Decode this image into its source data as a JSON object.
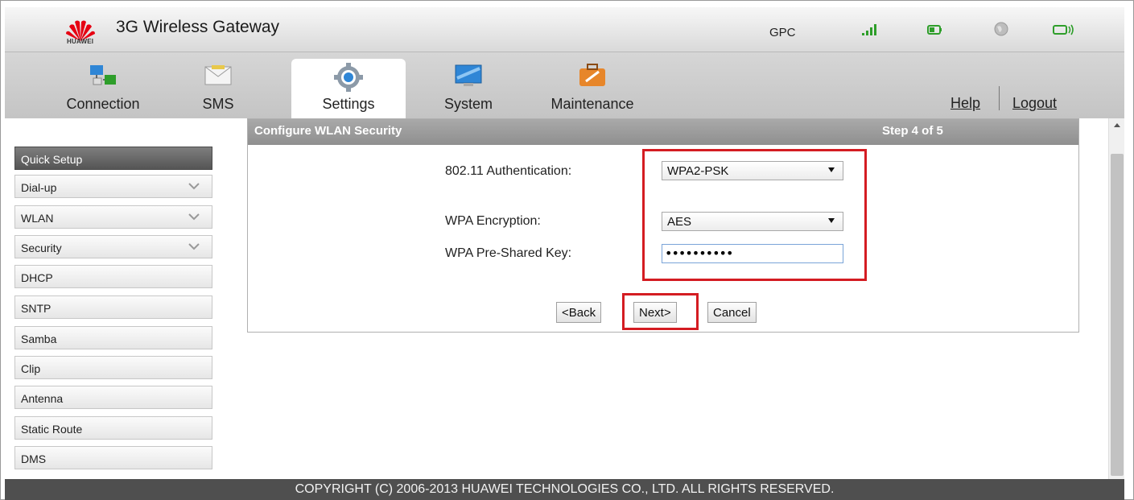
{
  "header": {
    "logo_text": "HUAWEI",
    "title": "3G Wireless Gateway",
    "operator": "GPC",
    "status_icons": [
      "signal-icon",
      "battery-icon",
      "globe-icon",
      "wifi-icon"
    ]
  },
  "nav": {
    "tabs": [
      {
        "label": "Connection",
        "icon": "connection-icon"
      },
      {
        "label": "SMS",
        "icon": "sms-icon"
      },
      {
        "label": "Settings",
        "icon": "settings-icon",
        "active": true
      },
      {
        "label": "System",
        "icon": "system-icon"
      },
      {
        "label": "Maintenance",
        "icon": "maintenance-icon"
      }
    ],
    "help": "Help",
    "logout": "Logout"
  },
  "sidebar": {
    "items": [
      {
        "label": "Quick Setup",
        "active": true
      },
      {
        "label": "Dial-up",
        "expandable": true
      },
      {
        "label": "WLAN",
        "expandable": true
      },
      {
        "label": "Security",
        "expandable": true
      },
      {
        "label": "DHCP"
      },
      {
        "label": "SNTP"
      },
      {
        "label": "Samba"
      },
      {
        "label": "Clip"
      },
      {
        "label": "Antenna"
      },
      {
        "label": "Static Route"
      },
      {
        "label": "DMS"
      }
    ]
  },
  "panel": {
    "title": "Configure WLAN Security",
    "step": "Step 4 of 5",
    "auth_label": "802.11 Authentication:",
    "auth_value": "WPA2-PSK",
    "enc_label": "WPA Encryption:",
    "enc_value": "AES",
    "key_label": "WPA Pre-Shared Key:",
    "key_value": "••••••••••",
    "back": "<Back",
    "next": "Next>",
    "cancel": "Cancel"
  },
  "footer": {
    "copyright": "COPYRIGHT (C) 2006-2013 HUAWEI TECHNOLOGIES CO., LTD. ALL RIGHTS RESERVED."
  },
  "colors": {
    "highlight": "#d41c22",
    "brand": "#e60012"
  }
}
